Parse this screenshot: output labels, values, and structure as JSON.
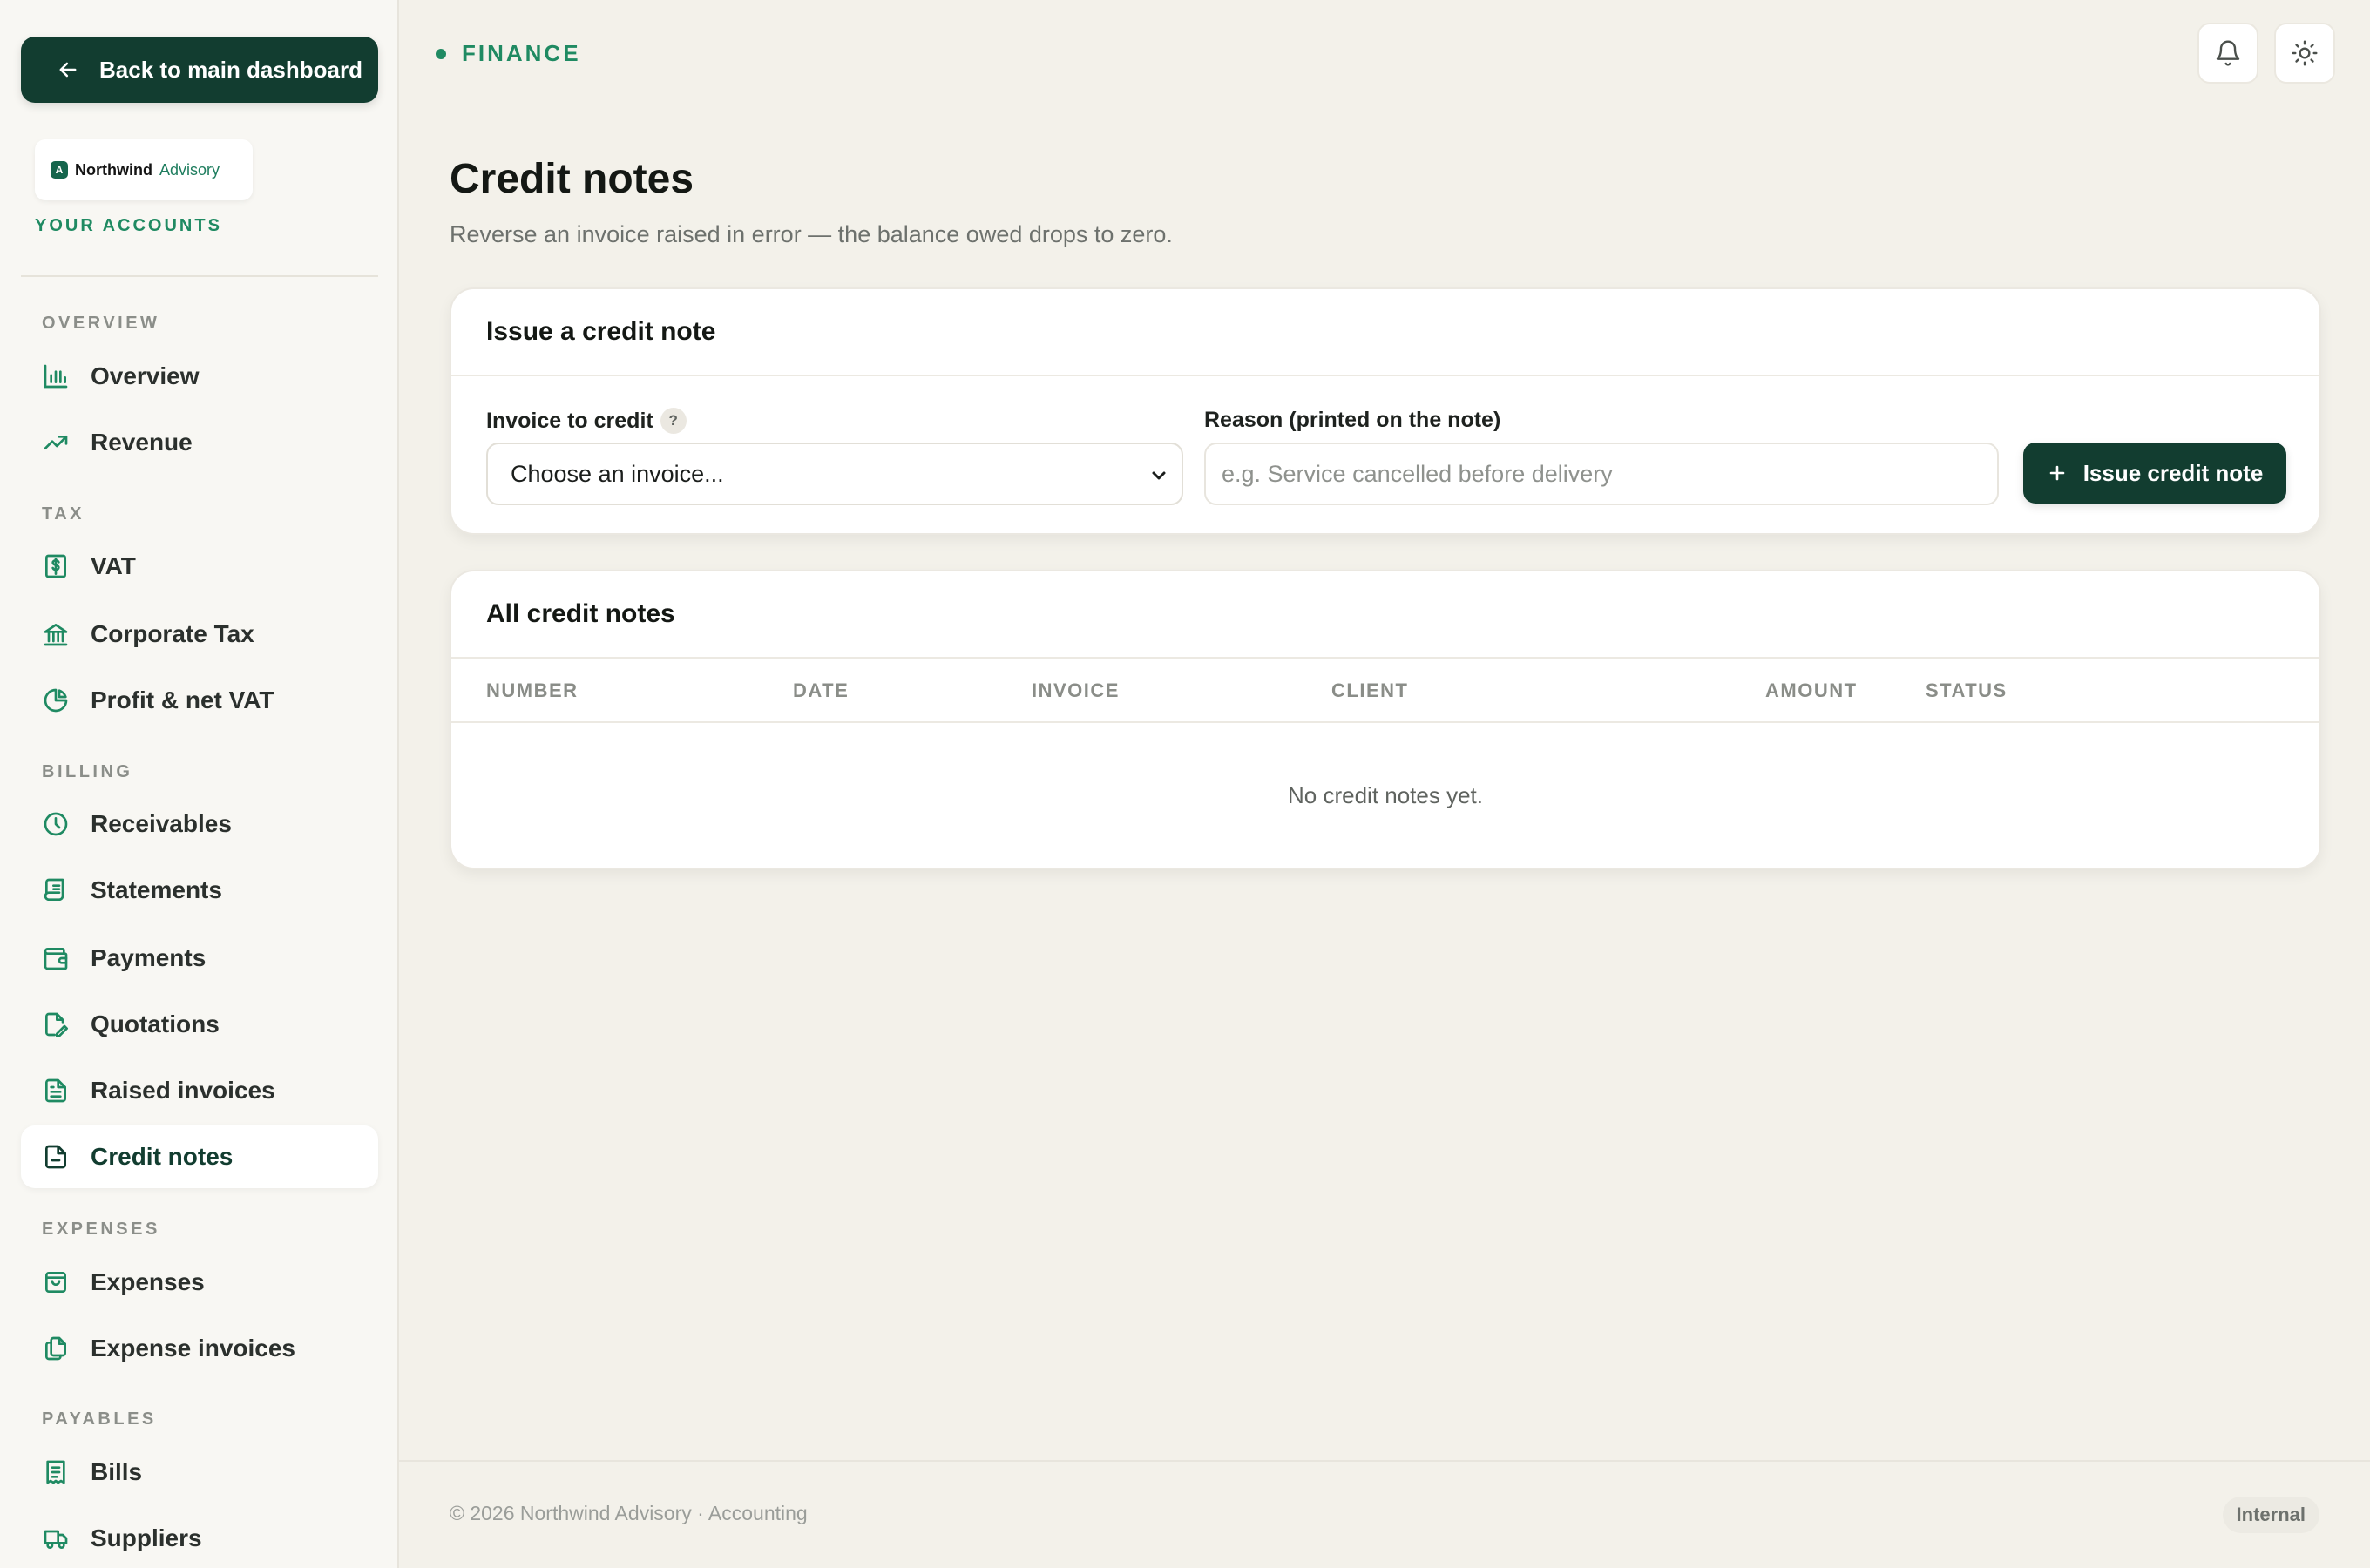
{
  "sidebar": {
    "back_label": "Back to main dashboard",
    "brand": {
      "mark": "A",
      "name": "Northwind",
      "sub": "Advisory"
    },
    "accounts_label": "YOUR ACCOUNTS",
    "sections": {
      "overview": "OVERVIEW",
      "tax": "TAX",
      "billing": "BILLING",
      "expenses": "EXPENSES",
      "payables": "PAYABLES"
    },
    "items": {
      "overview": "Overview",
      "revenue": "Revenue",
      "vat": "VAT",
      "corporate_tax": "Corporate Tax",
      "profit_vat": "Profit & net VAT",
      "receivables": "Receivables",
      "statements": "Statements",
      "payments": "Payments",
      "quotations": "Quotations",
      "raised_invoices": "Raised invoices",
      "credit_notes": "Credit notes",
      "expenses": "Expenses",
      "expense_invoices": "Expense invoices",
      "bills": "Bills",
      "suppliers": "Suppliers"
    },
    "active_item": "credit_notes"
  },
  "header": {
    "breadcrumb": "FINANCE",
    "icons": [
      "bell-icon",
      "sun-icon"
    ]
  },
  "page": {
    "title": "Credit notes",
    "subtitle": "Reverse an invoice raised in error — the balance owed drops to zero."
  },
  "issue_form": {
    "title": "Issue a credit note",
    "invoice_label": "Invoice to credit",
    "help_glyph": "?",
    "invoice_value": "Choose an invoice...",
    "reason_label": "Reason (printed on the note)",
    "reason_placeholder": "e.g. Service cancelled before delivery",
    "reason_value": "",
    "submit_label": "Issue credit note"
  },
  "credit_notes_table": {
    "title": "All credit notes",
    "columns": {
      "number": "NUMBER",
      "date": "DATE",
      "invoice": "INVOICE",
      "client": "CLIENT",
      "amount": "AMOUNT",
      "status": "STATUS"
    },
    "rows": [],
    "empty_text": "No credit notes yet."
  },
  "footer": {
    "text": "© 2026 Northwind Advisory · Accounting",
    "badge": "Internal"
  },
  "colors": {
    "primary": "#123d30",
    "accent": "#1f8a62",
    "background": "#f3f1ea"
  }
}
